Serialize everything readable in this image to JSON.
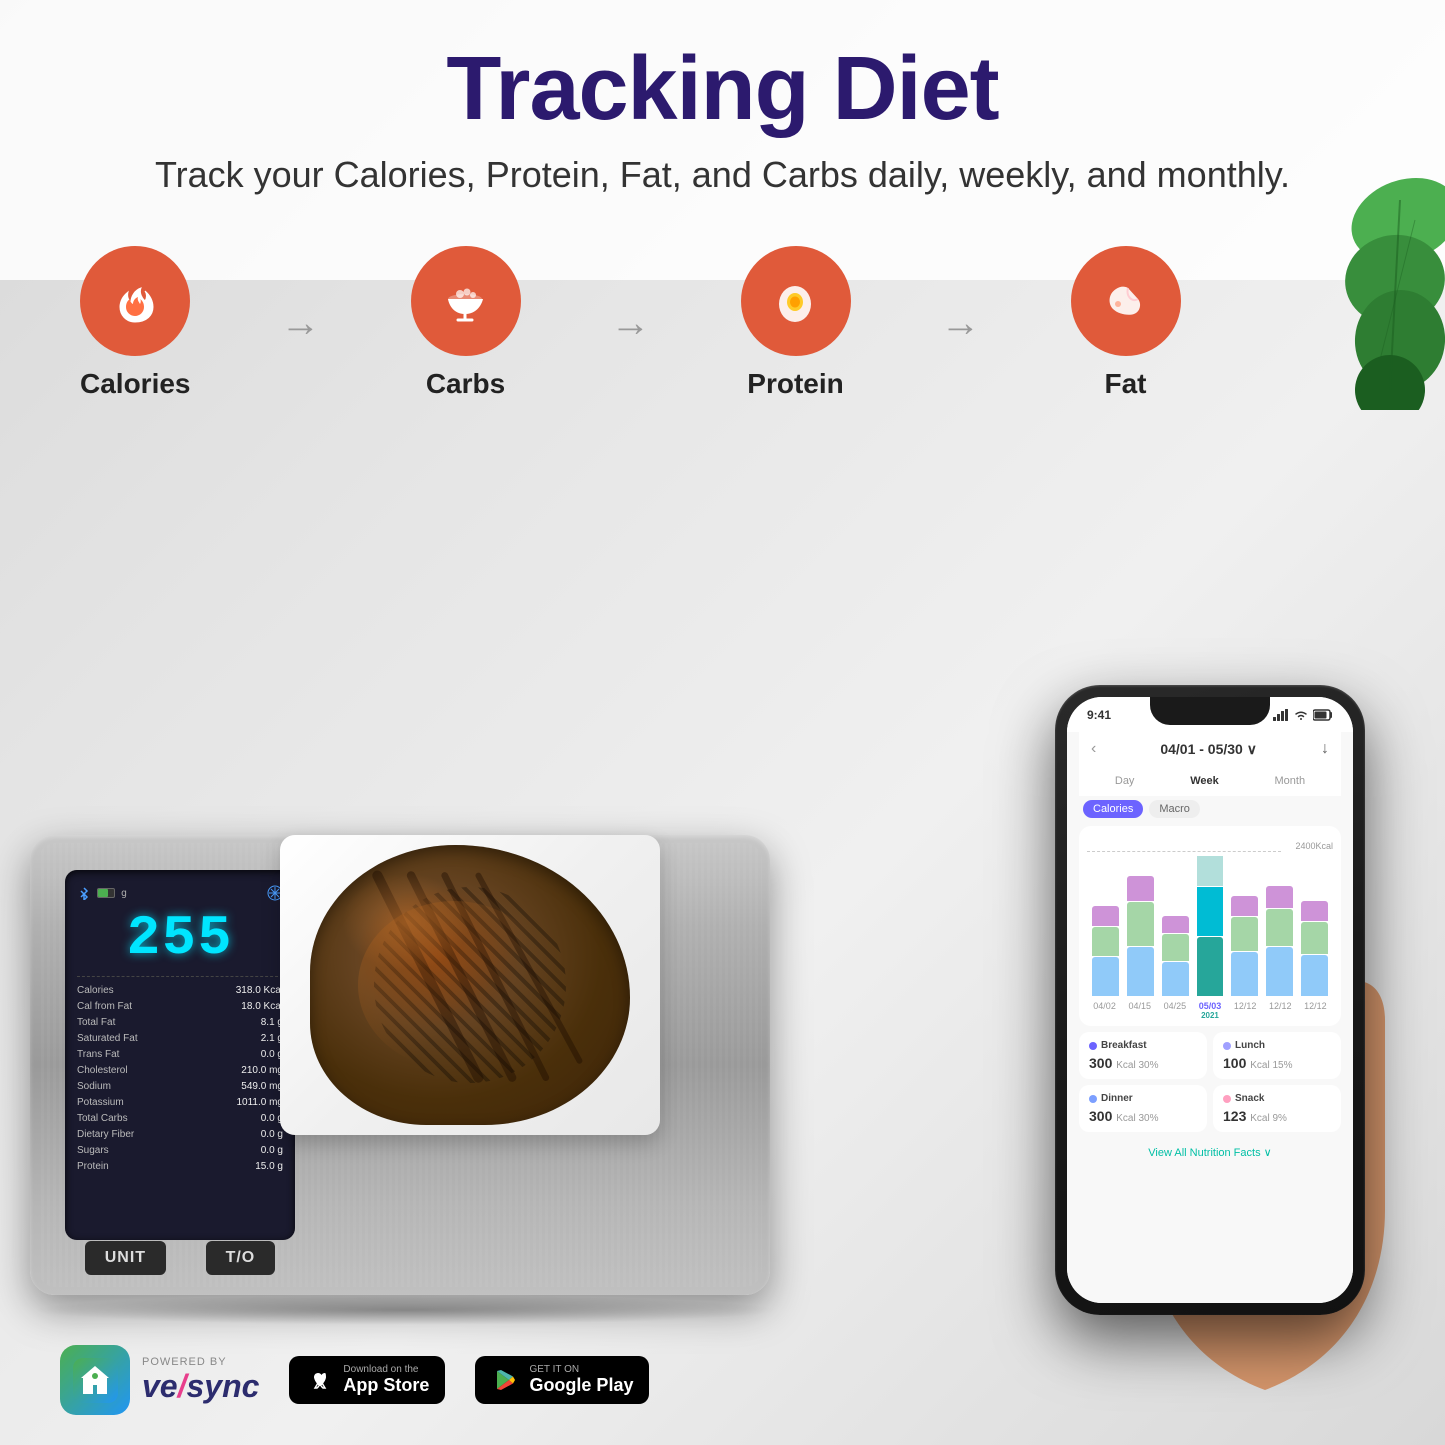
{
  "page": {
    "background": "#e0e0e0",
    "title": "Tracking Diet",
    "subtitle": "Track your Calories, Protein, Fat, and Carbs daily, weekly, and monthly."
  },
  "categories": [
    {
      "id": "calories",
      "label": "Calories",
      "icon": "flame"
    },
    {
      "id": "carbs",
      "label": "Carbs",
      "icon": "bowl"
    },
    {
      "id": "protein",
      "label": "Protein",
      "icon": "egg"
    },
    {
      "id": "fat",
      "label": "Fat",
      "icon": "meat"
    }
  ],
  "scale": {
    "weight_display": "255",
    "weight_unit": "g",
    "nutrition_facts": [
      {
        "label": "Calories",
        "value": "318.0",
        "unit": "Kcal"
      },
      {
        "label": "Cal from Fat",
        "value": "18.0",
        "unit": "Kcal"
      },
      {
        "label": "Total Fat",
        "value": "8.1",
        "unit": "g"
      },
      {
        "label": "Saturated Fat",
        "value": "2.1",
        "unit": "g"
      },
      {
        "label": "Trans Fat",
        "value": "0.0",
        "unit": "g"
      },
      {
        "label": "Cholesterol",
        "value": "210.0",
        "unit": "mg"
      },
      {
        "label": "Sodium",
        "value": "549.0",
        "unit": "mg"
      },
      {
        "label": "Potassium",
        "value": "1011.0",
        "unit": "mg"
      },
      {
        "label": "Total Carbs",
        "value": "0.0",
        "unit": "g"
      },
      {
        "label": "Dietary Fiber",
        "value": "0.0",
        "unit": "g"
      },
      {
        "label": "Sugars",
        "value": "0.0",
        "unit": "g"
      },
      {
        "label": "Protein",
        "value": "15.0",
        "unit": "g"
      }
    ],
    "buttons": [
      "UNIT",
      "T/O"
    ]
  },
  "app": {
    "status_bar": {
      "time": "9:41",
      "signal": "●●●",
      "wifi": "WiFi",
      "battery": "Battery"
    },
    "date_range": "04/01 - 05/30 ∨",
    "tabs": [
      "Day",
      "Week",
      "Month"
    ],
    "active_tab": "Week",
    "sub_tabs": [
      "Calories",
      "Macro"
    ],
    "active_sub_tab": "Calories",
    "chart": {
      "target_line": "2400Kcal",
      "x_labels": [
        "04/02",
        "04/15",
        "04/25",
        "05/03",
        "12/12",
        "12/12",
        "12/12"
      ],
      "active_label": "05/03",
      "year": "2021"
    },
    "meals": [
      {
        "type": "Breakfast",
        "color_class": "breakfast",
        "calories": "300",
        "unit": "Kcal",
        "percent": "30%"
      },
      {
        "type": "Lunch",
        "color_class": "lunch",
        "calories": "100",
        "unit": "Kcal",
        "percent": "15%"
      },
      {
        "type": "Dinner",
        "color_class": "dinner",
        "calories": "300",
        "unit": "Kcal",
        "percent": "30%"
      },
      {
        "type": "Snack",
        "color_class": "snack",
        "calories": "123",
        "unit": "Kcal",
        "percent": "9%"
      }
    ],
    "view_all_text": "View All Nutrition Facts ∨"
  },
  "bottom_bar": {
    "brand": {
      "powered_by": "POWERED BY",
      "name": "ve/ync"
    },
    "stores": [
      {
        "name": "App Store",
        "top": "Download on the",
        "main": "App Store",
        "icon": "apple"
      },
      {
        "name": "Google Play",
        "top": "GET IT ON",
        "main": "Google Play",
        "icon": "google"
      }
    ]
  }
}
